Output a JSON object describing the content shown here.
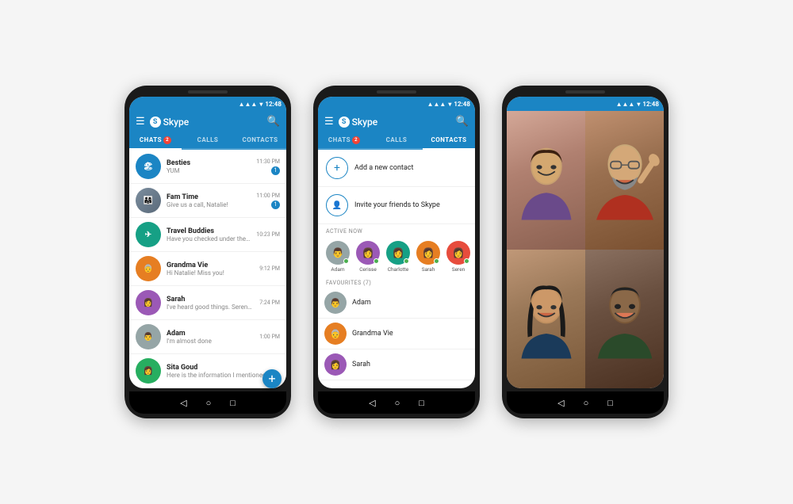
{
  "colors": {
    "skype_blue": "#1b85c4",
    "tab_active": "#ffffff",
    "tab_inactive": "rgba(255,255,255,0.7)",
    "unread_badge": "#f44336",
    "online_dot": "#4caf50"
  },
  "phone1": {
    "statusBar": {
      "time": "12:48"
    },
    "header": {
      "menu_label": "☰",
      "title": "Skype",
      "search_label": "🔍"
    },
    "tabs": [
      {
        "label": "CHATS",
        "badge": "2",
        "active": true
      },
      {
        "label": "CALLS",
        "badge": "",
        "active": false
      },
      {
        "label": "CONTACTS",
        "badge": "",
        "active": false
      }
    ],
    "chats": [
      {
        "name": "Besties",
        "preview": "YUM",
        "time": "11:30 PM",
        "unread": "1",
        "avatarType": "photo1"
      },
      {
        "name": "Fam Time",
        "preview": "Give us a call, Natalie!",
        "time": "11:00 PM",
        "unread": "1",
        "avatarType": "photo2"
      },
      {
        "name": "Travel Buddies",
        "preview": "Have you checked under the stairs?",
        "time": "10:23 PM",
        "unread": "",
        "avatarType": "photo3"
      },
      {
        "name": "Grandma Vie",
        "preview": "Hi Natalie! Miss you!",
        "time": "9:12 PM",
        "unread": "",
        "avatarType": "photo4"
      },
      {
        "name": "Sarah",
        "preview": "I've heard good things. Serena said she...",
        "time": "7:24 PM",
        "unread": "",
        "avatarType": "photo5"
      },
      {
        "name": "Adam",
        "preview": "I'm almost done",
        "time": "1:00 PM",
        "unread": "",
        "avatarType": "photo6"
      },
      {
        "name": "Sita Goud",
        "preview": "Here is the information I mentioned...",
        "time": "",
        "unread": "",
        "avatarType": "photo7"
      }
    ],
    "fab": "+"
  },
  "phone2": {
    "statusBar": {
      "time": "12:48"
    },
    "header": {
      "menu_label": "☰",
      "title": "Skype",
      "search_label": "🔍"
    },
    "tabs": [
      {
        "label": "CHATS",
        "badge": "2",
        "active": false
      },
      {
        "label": "CALLS",
        "badge": "",
        "active": false
      },
      {
        "label": "CONTACTS",
        "badge": "",
        "active": true
      }
    ],
    "actions": [
      {
        "icon": "+",
        "label": "Add a new contact"
      },
      {
        "icon": "👤",
        "label": "Invite your friends to Skype"
      }
    ],
    "activeNowLabel": "ACTIVE NOW",
    "activeContacts": [
      {
        "name": "Adam"
      },
      {
        "name": "Cerisse"
      },
      {
        "name": "Charlotte"
      },
      {
        "name": "Sarah"
      },
      {
        "name": "Seren"
      }
    ],
    "favouritesLabel": "FAVOURITES (7)",
    "favourites": [
      {
        "name": "Adam"
      },
      {
        "name": "Grandma Vie"
      },
      {
        "name": "Sarah"
      }
    ]
  },
  "phone3": {
    "statusBar": {
      "time": "12:48"
    },
    "videoParticipants": [
      {
        "label": "Top left - woman laughing"
      },
      {
        "label": "Top right - man waving"
      },
      {
        "label": "Bottom left - young woman smiling"
      },
      {
        "label": "Bottom right - young man smiling"
      }
    ]
  },
  "nav": {
    "back": "◁",
    "home": "○",
    "square": "□"
  }
}
